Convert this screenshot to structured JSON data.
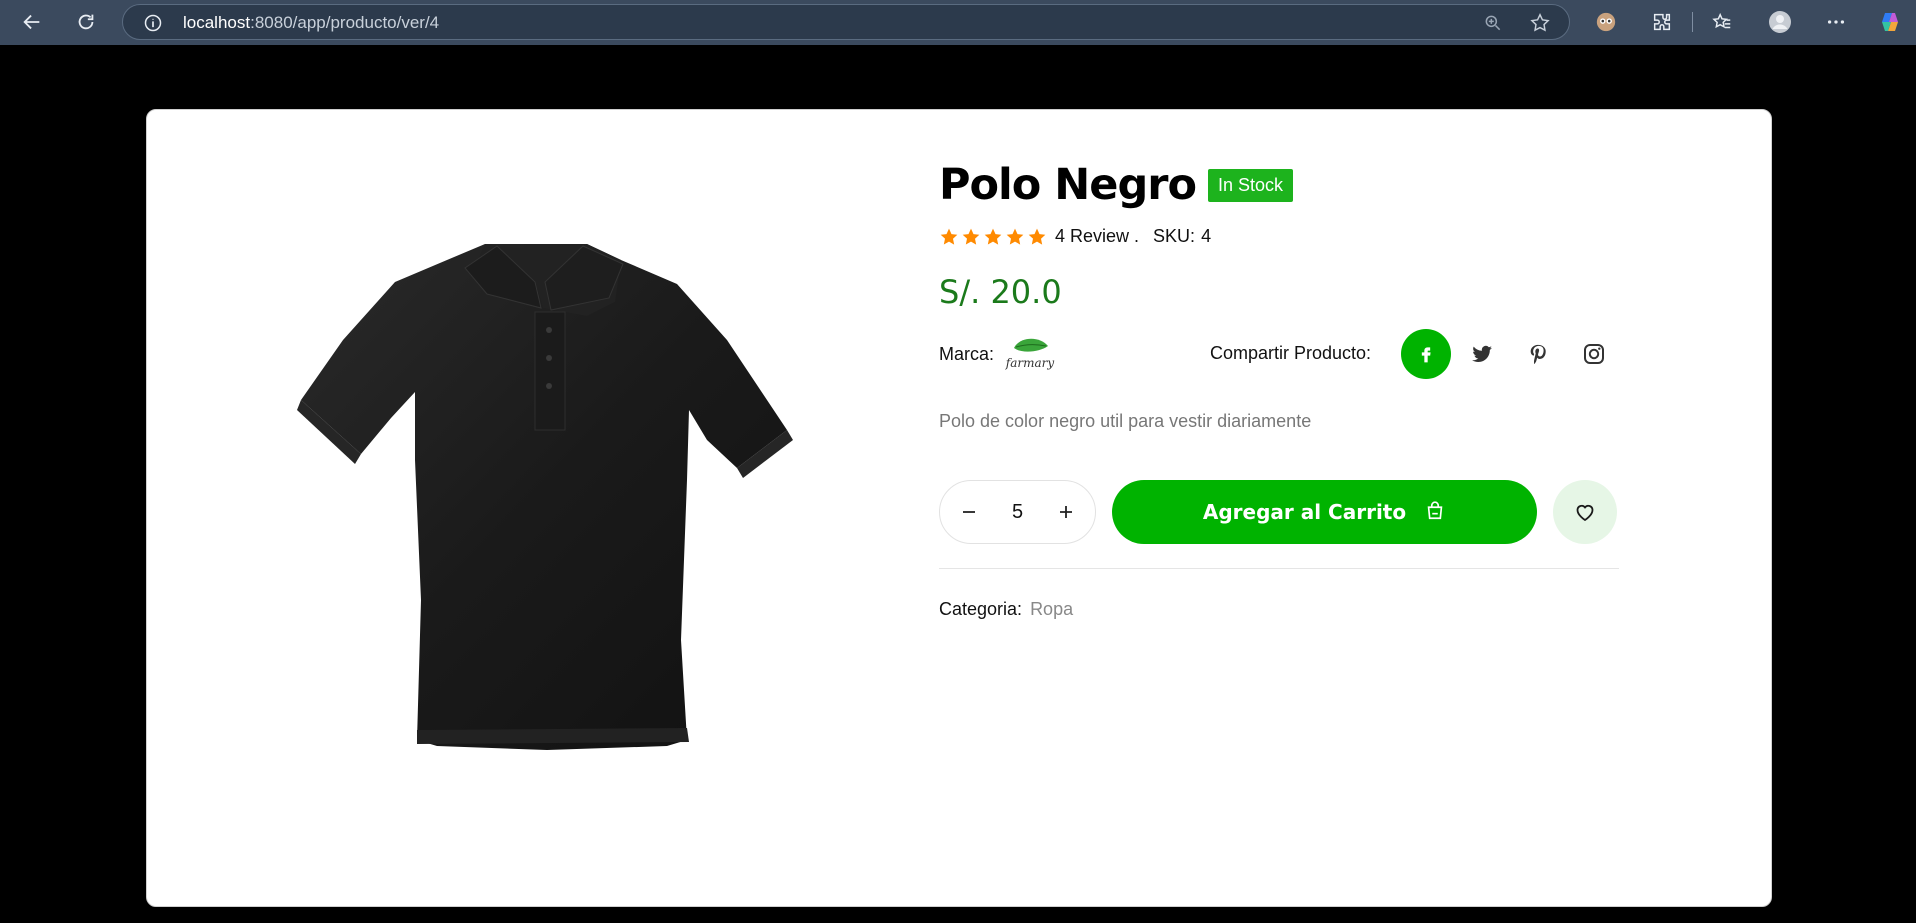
{
  "browser": {
    "url_host": "localhost",
    "url_path": ":8080/app/producto/ver/4"
  },
  "product": {
    "title": "Polo Negro",
    "stock_badge": "In Stock",
    "rating": 5,
    "rating_max": 5,
    "review_text": "4 Review .",
    "sku_label": "SKU:",
    "sku_value": "4",
    "price": "S/. 20.0",
    "brand_label": "Marca:",
    "brand_logo_text": "farmary",
    "share_label": "Compartir Producto:",
    "description": "Polo de color negro util para vestir diariamente",
    "quantity": "5",
    "add_to_cart_label": "Agregar al Carrito",
    "category_label": "Categoria:",
    "category_value": "Ropa"
  },
  "colors": {
    "accent_green": "#00b300",
    "price_green": "#1b7a1b",
    "star_orange": "#ff8a00",
    "chrome_bg": "#3b4a5e"
  },
  "icons": {
    "social": [
      "facebook-icon",
      "twitter-icon",
      "pinterest-icon",
      "instagram-icon"
    ]
  }
}
